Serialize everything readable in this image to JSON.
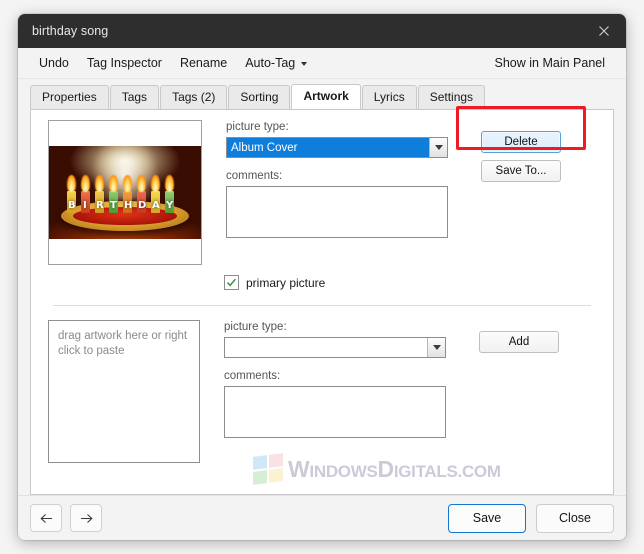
{
  "window": {
    "title": "birthday song",
    "close_icon": "close-icon"
  },
  "menubar": {
    "items": [
      {
        "label": "Undo"
      },
      {
        "label": "Tag Inspector"
      },
      {
        "label": "Rename"
      },
      {
        "label": "Auto-Tag",
        "has_caret": true
      }
    ],
    "right_label": "Show in Main Panel"
  },
  "tabs": [
    {
      "label": "Properties",
      "active": false
    },
    {
      "label": "Tags",
      "active": false
    },
    {
      "label": "Tags (2)",
      "active": false
    },
    {
      "label": "Sorting",
      "active": false
    },
    {
      "label": "Artwork",
      "active": true
    },
    {
      "label": "Lyrics",
      "active": false
    },
    {
      "label": "Settings",
      "active": false
    }
  ],
  "artwork": {
    "existing": {
      "image_alt": "birthday cake with lit candles spelling BIRTHDAY",
      "candle_letters": [
        "B",
        "I",
        "R",
        "T",
        "H",
        "D",
        "A",
        "Y"
      ],
      "picture_type_label": "picture type:",
      "picture_type_value": "Album Cover",
      "comments_label": "comments:",
      "comments_value": "",
      "primary_checkbox_label": "primary picture",
      "primary_checked": true,
      "delete_button": "Delete",
      "save_to_button": "Save To..."
    },
    "empty": {
      "placeholder": "drag artwork here or right click to paste",
      "picture_type_label": "picture type:",
      "picture_type_value": "",
      "comments_label": "comments:",
      "comments_value": "",
      "add_button": "Add"
    }
  },
  "watermark": {
    "text_first": "W",
    "text_second": "INDOWS",
    "text_third": "D",
    "text_fourth": "IGITALS.COM"
  },
  "footer": {
    "back_icon": "arrow-left-icon",
    "forward_icon": "arrow-right-icon",
    "save_label": "Save",
    "close_label": "Close"
  },
  "colors": {
    "titlebar": "#2e2e2e",
    "accent": "#0f7ddb",
    "annotation": "#ee1b24",
    "check": "#2e8b3f"
  }
}
